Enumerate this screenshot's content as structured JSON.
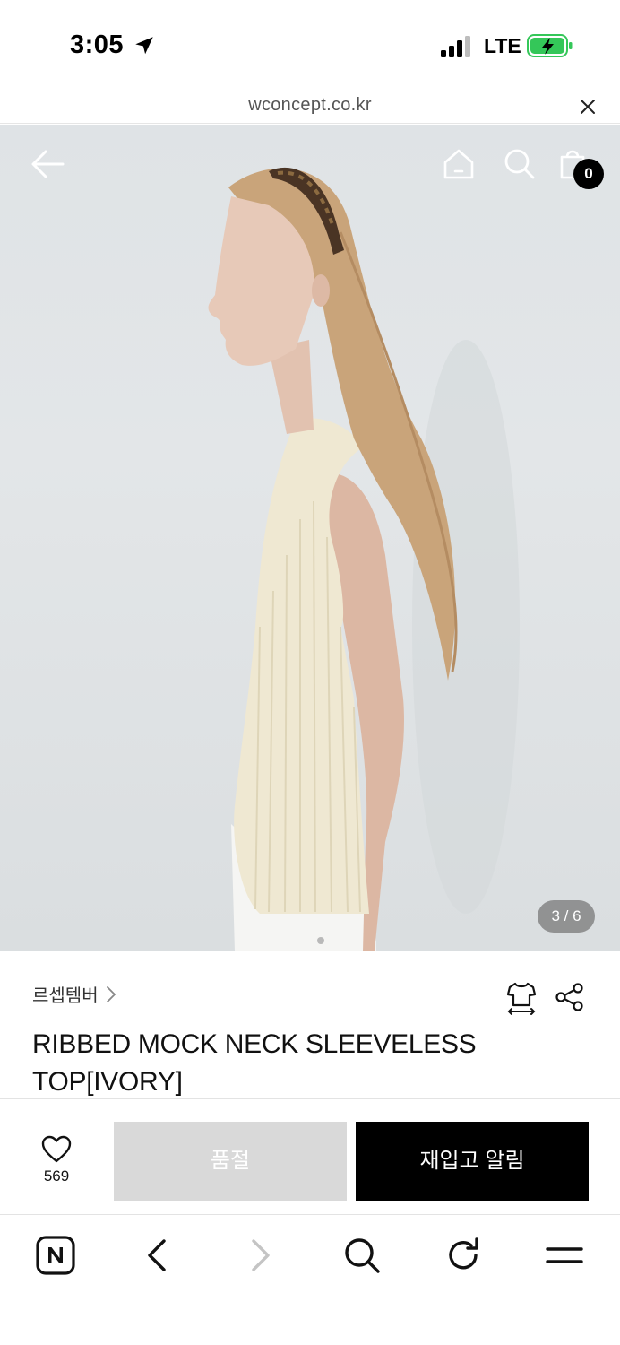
{
  "status_bar": {
    "time": "3:05",
    "network": "LTE",
    "icons": [
      "location-arrow-icon",
      "signal-icon",
      "battery-charging-icon"
    ]
  },
  "browser": {
    "url": "wconcept.co.kr",
    "close_icon": "close-icon",
    "toolbar_icons": [
      "naver-icon",
      "back-icon",
      "forward-icon",
      "search-icon",
      "reload-icon",
      "menu-icon"
    ]
  },
  "header": {
    "icons": [
      "back-arrow-icon",
      "home-icon",
      "search-icon",
      "shopping-bag-icon"
    ],
    "cart_count": "0"
  },
  "gallery": {
    "counter": "3 / 6",
    "current": 3,
    "total": 6
  },
  "product": {
    "brand": "르셉템버",
    "title_line1": "RIBBED MOCK NECK SLEEVELESS",
    "title_line2": "TOP[IVORY]"
  },
  "actions": {
    "like_count": "569",
    "soldout_label": "품절",
    "restock_label": "재입고 알림"
  },
  "colors": {
    "accent": "#000000",
    "disabled": "#d9d9d9",
    "battery": "#34c759"
  }
}
